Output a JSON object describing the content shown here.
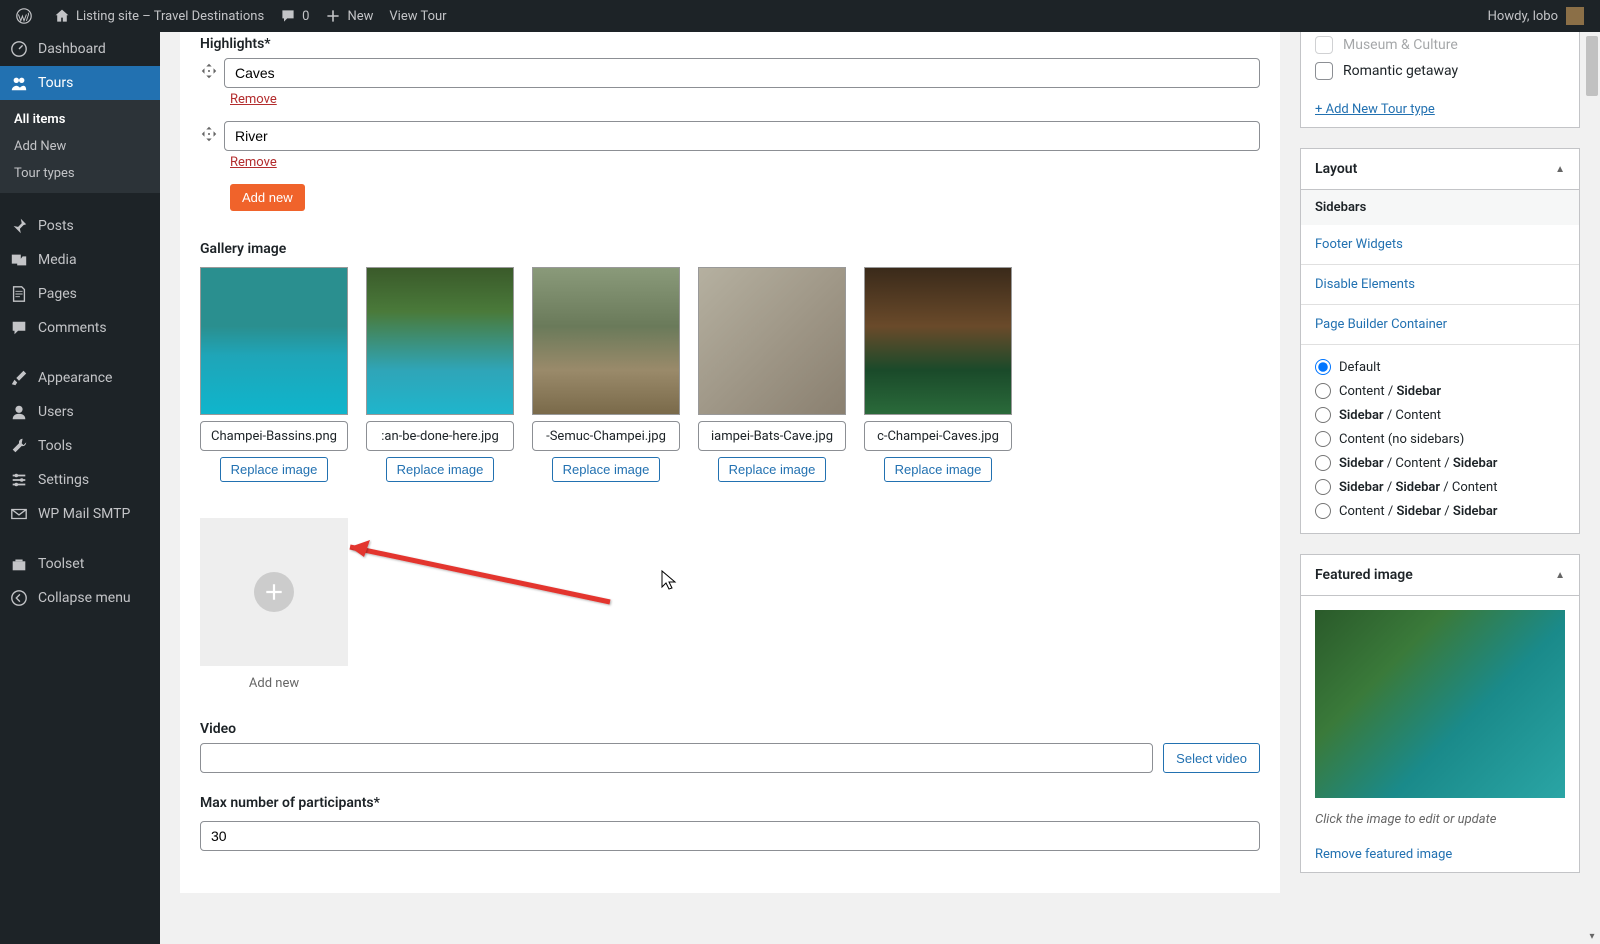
{
  "adminbar": {
    "site_title": "Listing site – Travel Destinations",
    "comment_count": "0",
    "new_label": "New",
    "view_tour_label": "View Tour",
    "howdy": "Howdy, lobo"
  },
  "sidebar": {
    "dashboard": "Dashboard",
    "tours": "Tours",
    "tours_sub": {
      "all_items": "All items",
      "add_new": "Add New",
      "tour_types": "Tour types"
    },
    "posts": "Posts",
    "media": "Media",
    "pages": "Pages",
    "comments": "Comments",
    "appearance": "Appearance",
    "users": "Users",
    "tools": "Tools",
    "settings": "Settings",
    "wp_mail_smtp": "WP Mail SMTP",
    "toolset": "Toolset",
    "collapse": "Collapse menu"
  },
  "main": {
    "highlights_label": "Highlights*",
    "highlights": [
      "Caves",
      "River"
    ],
    "remove_label": "Remove",
    "add_new_label": "Add new",
    "gallery_label": "Gallery image",
    "gallery": [
      {
        "filename": "Champei-Bassins.png",
        "thumb_class": "sky"
      },
      {
        "filename": ":an-be-done-here.jpg",
        "thumb_class": "forest"
      },
      {
        "filename": "-Semuc-Champei.jpg",
        "thumb_class": "bridge"
      },
      {
        "filename": "iampei-Bats-Cave.jpg",
        "thumb_class": "bats"
      },
      {
        "filename": "c-Champei-Caves.jpg",
        "thumb_class": "cave"
      }
    ],
    "replace_image_label": "Replace image",
    "add_new_tile_label": "Add new",
    "video_label": "Video",
    "video_value": "",
    "select_video_label": "Select video",
    "max_participants_label": "Max number of participants*",
    "max_participants_value": "30"
  },
  "tour_type": {
    "museum": "Museum & Culture",
    "romantic": "Romantic getaway",
    "add_new": "+ Add New Tour type"
  },
  "layout": {
    "title": "Layout",
    "sidebars_label": "Sidebars",
    "links": [
      "Footer Widgets",
      "Disable Elements",
      "Page Builder Container"
    ],
    "options": [
      {
        "label_parts": [
          {
            "t": "Default",
            "b": false
          }
        ],
        "checked": true
      },
      {
        "label_parts": [
          {
            "t": "Content / ",
            "b": false
          },
          {
            "t": "Sidebar",
            "b": true
          }
        ],
        "checked": false
      },
      {
        "label_parts": [
          {
            "t": "Sidebar",
            "b": true
          },
          {
            "t": " / Content",
            "b": false
          }
        ],
        "checked": false
      },
      {
        "label_parts": [
          {
            "t": "Content (no sidebars)",
            "b": false
          }
        ],
        "checked": false
      },
      {
        "label_parts": [
          {
            "t": "Sidebar",
            "b": true
          },
          {
            "t": " / Content / ",
            "b": false
          },
          {
            "t": "Sidebar",
            "b": true
          }
        ],
        "checked": false
      },
      {
        "label_parts": [
          {
            "t": "Sidebar",
            "b": true
          },
          {
            "t": " / ",
            "b": false
          },
          {
            "t": "Sidebar",
            "b": true
          },
          {
            "t": " / Content",
            "b": false
          }
        ],
        "checked": false
      },
      {
        "label_parts": [
          {
            "t": "Content / ",
            "b": false
          },
          {
            "t": "Sidebar",
            "b": true
          },
          {
            "t": " / ",
            "b": false
          },
          {
            "t": "Sidebar",
            "b": true
          }
        ],
        "checked": false
      }
    ]
  },
  "featured": {
    "title": "Featured image",
    "hint": "Click the image to edit or update",
    "remove": "Remove featured image"
  }
}
